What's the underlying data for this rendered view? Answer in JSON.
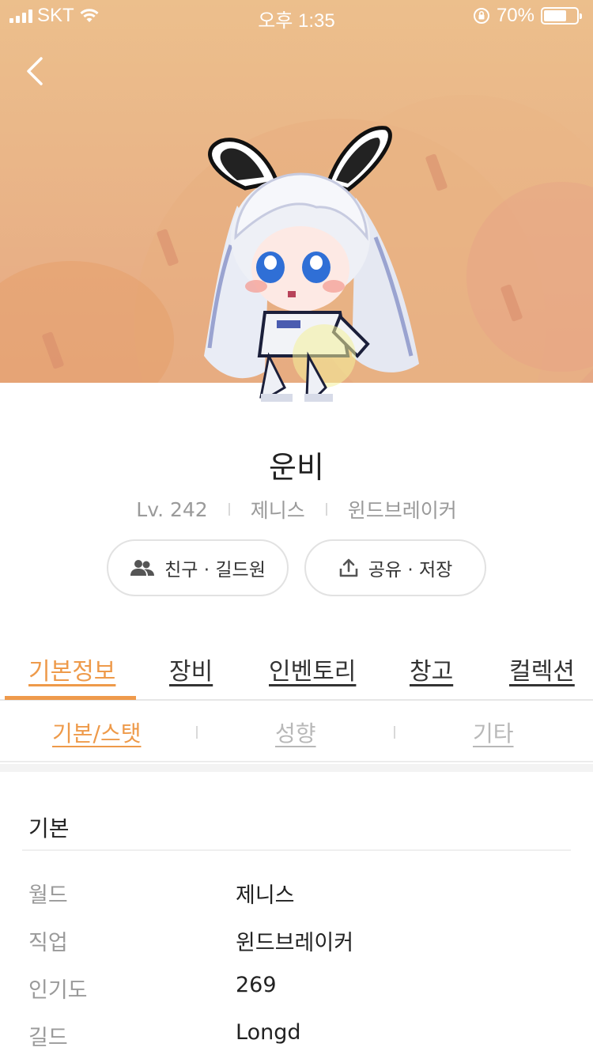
{
  "status_bar": {
    "carrier": "SKT",
    "time": "오후 1:35",
    "battery": "70%",
    "battery_level": 0.7
  },
  "character": {
    "name": "운비",
    "level": "Lv. 242",
    "world": "제니스",
    "job": "윈드브레이커"
  },
  "actions": {
    "friends_label": "친구 · 길드원",
    "share_label": "공유 · 저장"
  },
  "tabs": [
    {
      "label": "기본정보",
      "active": true
    },
    {
      "label": "장비",
      "active": false
    },
    {
      "label": "인벤토리",
      "active": false
    },
    {
      "label": "창고",
      "active": false
    },
    {
      "label": "컬렉션",
      "active": false
    }
  ],
  "subtabs": [
    {
      "label": "기본/스탯",
      "active": true
    },
    {
      "label": "성향",
      "active": false
    },
    {
      "label": "기타",
      "active": false
    }
  ],
  "basic": {
    "title": "기본",
    "rows": [
      {
        "key": "월드",
        "value": "제니스"
      },
      {
        "key": "직업",
        "value": "윈드브레이커"
      },
      {
        "key": "인기도",
        "value": "269"
      },
      {
        "key": "길드",
        "value": "Longd"
      }
    ]
  },
  "colors": {
    "accent": "#ee9a4a",
    "hero_bg": "#ecbf8c"
  }
}
